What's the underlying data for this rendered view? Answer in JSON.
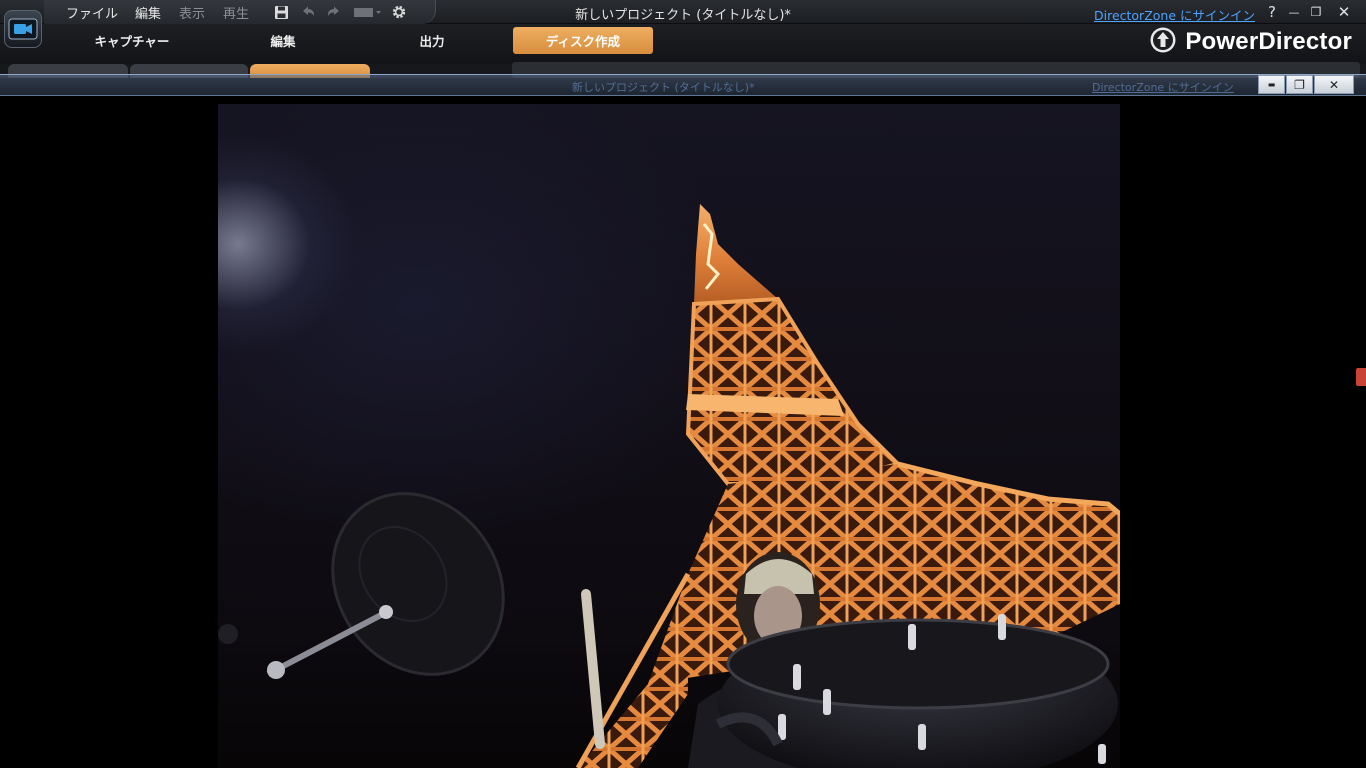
{
  "menu": {
    "items": [
      "ファイル",
      "編集",
      "表示",
      "再生"
    ],
    "disabled": [
      false,
      false,
      true,
      true
    ]
  },
  "window": {
    "title": "新しいプロジェクト (タイトルなし)*",
    "signin_label": "DirectorZone にサインイン",
    "help_glyph": "?",
    "minimize_glyph": "—",
    "restore_glyph": "❐",
    "close_glyph": "✕"
  },
  "modes": {
    "tabs": [
      "キャプチャー",
      "編集",
      "出力",
      "ディスク作成"
    ],
    "active_index": 3
  },
  "brand": {
    "name": "PowerDirector"
  },
  "player": {
    "ghost_title": "新しいプロジェクト (タイトルなし)*",
    "ghost_signin": "DirectorZone にサインイン",
    "minimize_glyph": "▬",
    "restore_glyph": "❐",
    "close_glyph": "✕"
  },
  "icons": {
    "app": "powerdirector-app-icon",
    "save": "floppy-disk-icon",
    "undo": "undo-icon",
    "redo": "redo-icon",
    "display": "monitor-dropdown-icon",
    "settings": "gear-icon",
    "brand": "upload-circle-icon"
  },
  "colors": {
    "accent": "#e39c4c",
    "link": "#4fa3ff",
    "tower": "#e0813a"
  },
  "video": {
    "content": "night-tower-drummer-frame"
  }
}
